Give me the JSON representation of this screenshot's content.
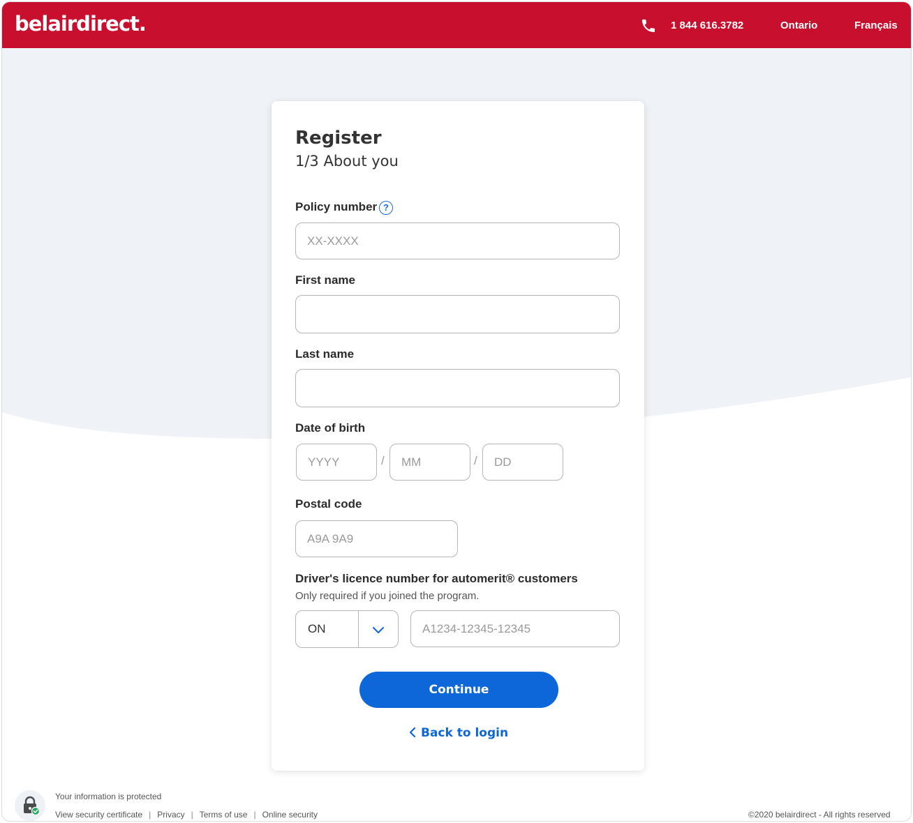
{
  "header": {
    "logo": "belairdirect.",
    "phone_icon": "phone-icon",
    "phone": "1 844 616.3782",
    "province": "Ontario",
    "language": "Français",
    "brand_color": "#c8102e"
  },
  "form": {
    "title": "Register",
    "step": "1/3 About you",
    "policy": {
      "label": "Policy number",
      "help_icon": "question-circle-icon",
      "placeholder": "XX-XXXX",
      "value": ""
    },
    "first_name": {
      "label": "First name",
      "value": ""
    },
    "last_name": {
      "label": "Last name",
      "value": ""
    },
    "dob": {
      "label": "Date of birth",
      "year_placeholder": "YYYY",
      "month_placeholder": "MM",
      "day_placeholder": "DD",
      "separator": "/"
    },
    "postal": {
      "label": "Postal code",
      "placeholder": "A9A 9A9"
    },
    "licence": {
      "label": "Driver's licence number for automerit® customers",
      "hint": "Only required if you joined the program.",
      "province_value": "ON",
      "placeholder": "A1234-12345-12345"
    },
    "continue_label": "Continue",
    "back_label": "Back to login",
    "accent_color": "#0d67d8"
  },
  "footer": {
    "lock_icon": "lock-check-icon",
    "protected": "Your information is protected",
    "links": [
      "View security certificate",
      "Privacy",
      "Terms of use",
      "Online security"
    ],
    "copyright": "©2020 belairdirect - All rights reserved"
  }
}
